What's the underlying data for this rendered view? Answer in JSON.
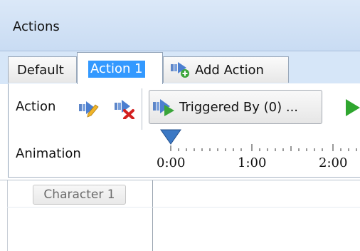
{
  "panel": {
    "title": "Actions"
  },
  "tabs": [
    {
      "label": "Default"
    },
    {
      "label": "Action 1",
      "selected": true
    },
    {
      "label": "Add Action",
      "icon": "add-action-icon"
    }
  ],
  "toolbar": {
    "action_label": "Action",
    "edit_icon": "edit-action-icon",
    "delete_icon": "delete-action-icon",
    "triggered_by_label": "Triggered By (0) ...",
    "triggered_icon": "trigger-icon",
    "play_icon": "play-icon"
  },
  "animation": {
    "label": "Animation",
    "time_labels": [
      "0:00",
      "1:00",
      "2:00"
    ]
  },
  "character": {
    "label": "Character 1"
  },
  "colors": {
    "header_bg": "#d4e4f7",
    "selection": "#3399ff",
    "play": "#2fa62f",
    "marker": "#3b78c4"
  }
}
